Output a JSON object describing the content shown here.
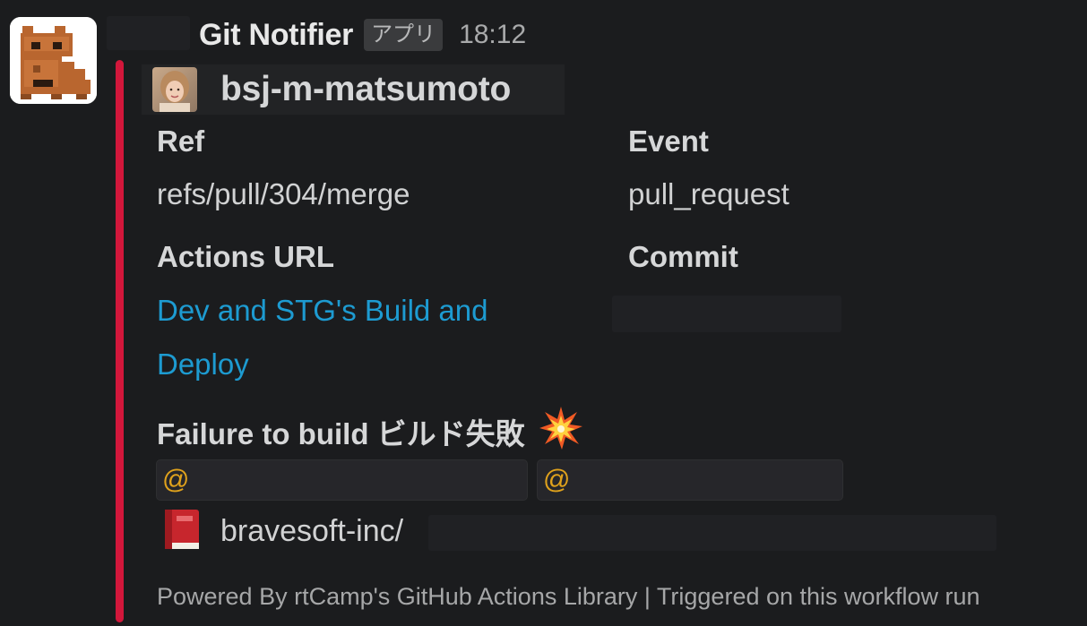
{
  "header": {
    "app_name": "Git Notifier",
    "app_badge": "アプリ",
    "timestamp": "18:12"
  },
  "attachment": {
    "bar_color": "#d2173b",
    "author": {
      "name": "bsj-m-matsumoto"
    },
    "fields": {
      "ref": {
        "title": "Ref",
        "value": "refs/pull/304/merge"
      },
      "event": {
        "title": "Event",
        "value": "pull_request"
      },
      "actions_url": {
        "title": "Actions URL",
        "link_line1": "Dev and STG's Build and",
        "link_line2": "Deploy"
      },
      "commit": {
        "title": "Commit"
      }
    },
    "status": {
      "text": "Failure to build ビルド失敗",
      "icon": "collision-icon"
    },
    "mentions": [
      "@",
      "@"
    ],
    "repo": {
      "icon": "red-book-icon",
      "text": "bravesoft-inc/"
    },
    "footer": {
      "powered": "Powered By rtCamp's GitHub Actions Library",
      "separator": "|",
      "triggered": "Triggered on this workflow run"
    }
  },
  "colors": {
    "background": "#1b1c1e",
    "link": "#1d9bd1",
    "mention_at": "#e0a21c",
    "accent_bar": "#d2173b"
  }
}
